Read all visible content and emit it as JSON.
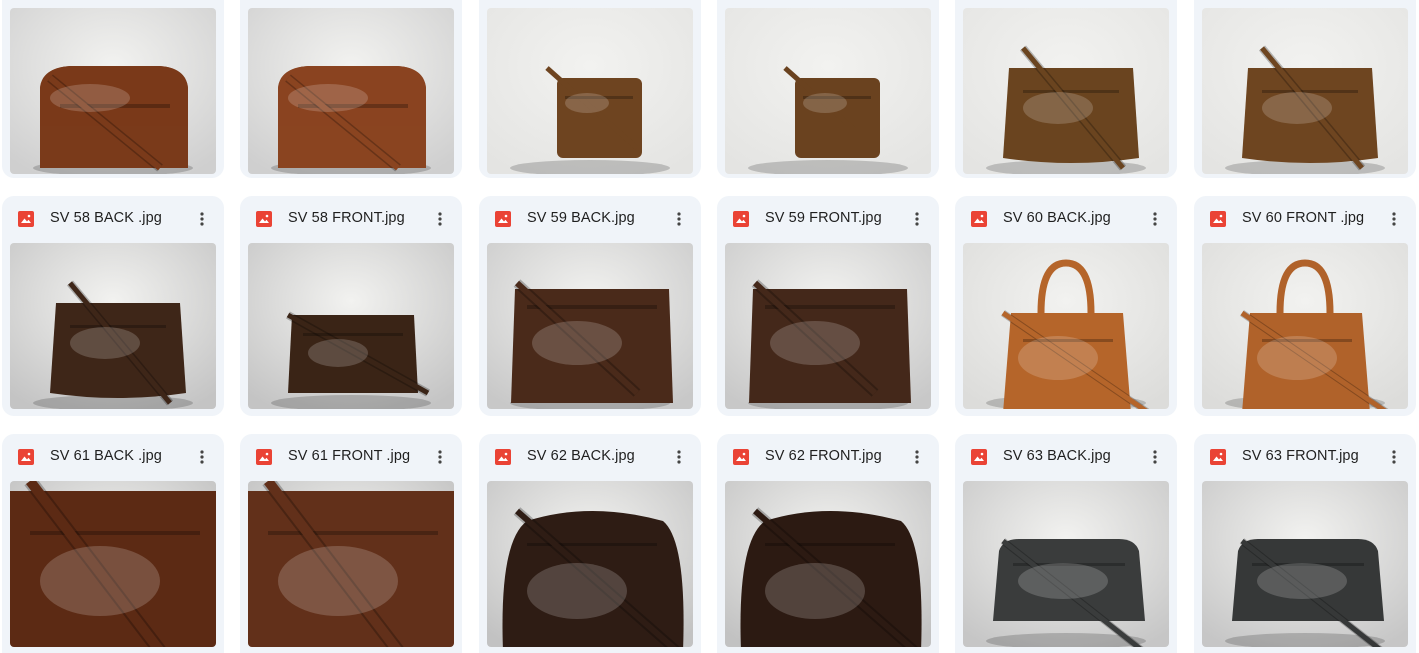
{
  "colors": {
    "card_bg": "#f0f4f9",
    "image_icon": "#ea4335",
    "text": "#1f1f1f"
  },
  "rows": [
    {
      "files": [
        {
          "name": "",
          "bag": {
            "color": "#7a3a1a",
            "style": "flap",
            "bg": "#cfcfcf"
          }
        },
        {
          "name": "",
          "bag": {
            "color": "#8a4420",
            "style": "flap",
            "bg": "#cfcfcf"
          }
        },
        {
          "name": "",
          "bag": {
            "color": "#6e4420",
            "style": "small",
            "bg": "#e4e4e2"
          }
        },
        {
          "name": "",
          "bag": {
            "color": "#6a421f",
            "style": "small",
            "bg": "#e4e4e2"
          }
        },
        {
          "name": "",
          "bag": {
            "color": "#6a441f",
            "style": "wide",
            "bg": "#e4e4e2"
          }
        },
        {
          "name": "",
          "bag": {
            "color": "#6e4520",
            "style": "wide",
            "bg": "#e4e4e2"
          }
        }
      ]
    },
    {
      "files": [
        {
          "name": "SV 58 BACK .jpg",
          "bag": {
            "color": "#3e2618",
            "style": "wide",
            "bg": "#c4c4c4"
          }
        },
        {
          "name": "SV 58 FRONT.jpg",
          "bag": {
            "color": "#3a2416",
            "style": "smallwide",
            "bg": "#c4c4c4"
          }
        },
        {
          "name": "SV 59 BACK.jpg",
          "bag": {
            "color": "#4a2a1a",
            "style": "big",
            "bg": "#c8c8c8"
          }
        },
        {
          "name": "SV 59 FRONT.jpg",
          "bag": {
            "color": "#44281a",
            "style": "big",
            "bg": "#c8c8c8"
          }
        },
        {
          "name": "SV 60 BACK.jpg",
          "bag": {
            "color": "#b5652a",
            "style": "tote",
            "bg": "#dcdcda"
          }
        },
        {
          "name": "SV 60 FRONT .jpg",
          "bag": {
            "color": "#b0622a",
            "style": "tote",
            "bg": "#dcdcda"
          }
        }
      ]
    },
    {
      "files": [
        {
          "name": "SV 61 BACK .jpg",
          "bag": {
            "color": "#5c2a14",
            "style": "close",
            "bg": "#bcbcbc"
          }
        },
        {
          "name": "SV 61 FRONT .jpg",
          "bag": {
            "color": "#62301a",
            "style": "close",
            "bg": "#bcbcbc"
          }
        },
        {
          "name": "SV 62 BACK.jpg",
          "bag": {
            "color": "#2e1c14",
            "style": "hobo",
            "bg": "#c2c2c2"
          }
        },
        {
          "name": "SV 62 FRONT.jpg",
          "bag": {
            "color": "#2c1a12",
            "style": "hobo",
            "bg": "#c2c2c2"
          }
        },
        {
          "name": "SV 63 BACK.jpg",
          "bag": {
            "color": "#3a3c3c",
            "style": "camera",
            "bg": "#c6c6c6"
          }
        },
        {
          "name": "SV 63 FRONT.jpg",
          "bag": {
            "color": "#363838",
            "style": "camera",
            "bg": "#c6c6c6"
          }
        }
      ]
    }
  ]
}
